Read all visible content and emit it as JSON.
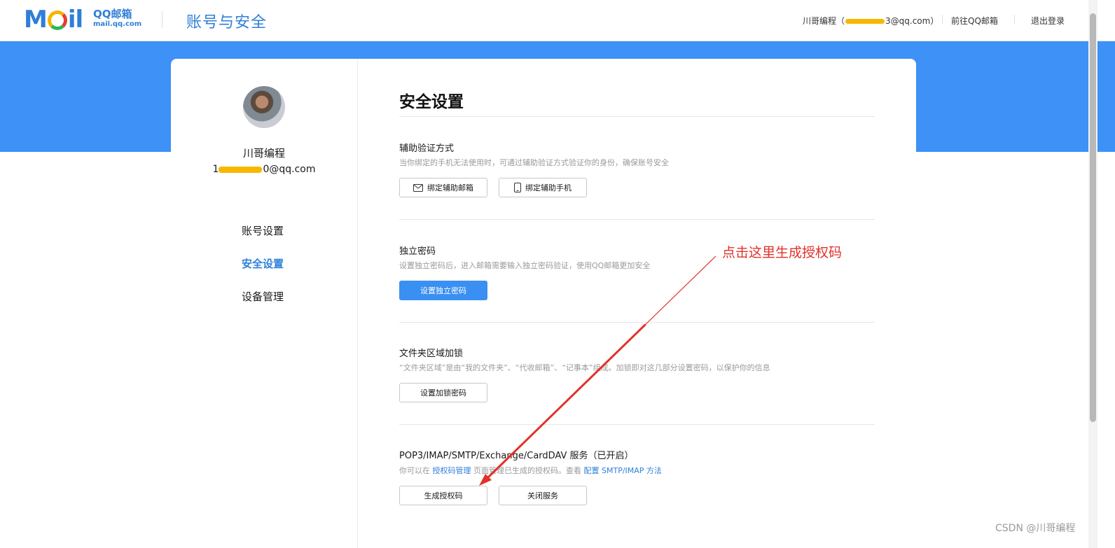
{
  "header": {
    "logo_mark": "M",
    "logo_mark_tail": "il",
    "logo_cn": "QQ邮箱",
    "logo_en": "mail.qq.com",
    "page_heading": "账号与安全",
    "user_prefix": "川哥编程（",
    "user_suffix": "3@qq.com）",
    "goto_mail": "前往QQ邮箱",
    "logout": "退出登录"
  },
  "sidebar": {
    "name": "川哥编程",
    "email_prefix": "1",
    "email_suffix": "0@qq.com",
    "items": [
      {
        "label": "账号设置"
      },
      {
        "label": "安全设置"
      },
      {
        "label": "设备管理"
      }
    ]
  },
  "content": {
    "title": "安全设置",
    "sections": [
      {
        "title": "辅助验证方式",
        "desc": "当你绑定的手机无法使用时，可通过辅助验证方式验证你的身份，确保账号安全",
        "buttons": [
          "绑定辅助邮箱",
          "绑定辅助手机"
        ]
      },
      {
        "title": "独立密码",
        "desc": "设置独立密码后，进入邮箱需要输入独立密码验证，使用QQ邮箱更加安全",
        "buttons": [
          "设置独立密码"
        ]
      },
      {
        "title": "文件夹区域加锁",
        "desc": "“文件夹区域”是由“我的文件夹”、“代收邮箱”、“记事本”组成。加锁即对这几部分设置密码，以保护你的信息",
        "buttons": [
          "设置加锁密码"
        ]
      },
      {
        "title": "POP3/IMAP/SMTP/Exchange/CardDAV 服务（已开启）",
        "desc_a": "你可以在 ",
        "desc_link1": "授权码管理",
        "desc_b": " 页面管理已生成的授权码。查看 ",
        "desc_link2": "配置 SMTP/IMAP 方法",
        "buttons": [
          "生成授权码",
          "关闭服务"
        ]
      }
    ]
  },
  "annotation": {
    "text": "点击这里生成授权码",
    "color": "#e2312a"
  },
  "watermark": "CSDN @川哥编程",
  "colors": {
    "brand_blue": "#2f7fd8",
    "band_blue": "#3d91f7",
    "primary_button": "#3a8ff3",
    "redaction": "#f5b800"
  }
}
